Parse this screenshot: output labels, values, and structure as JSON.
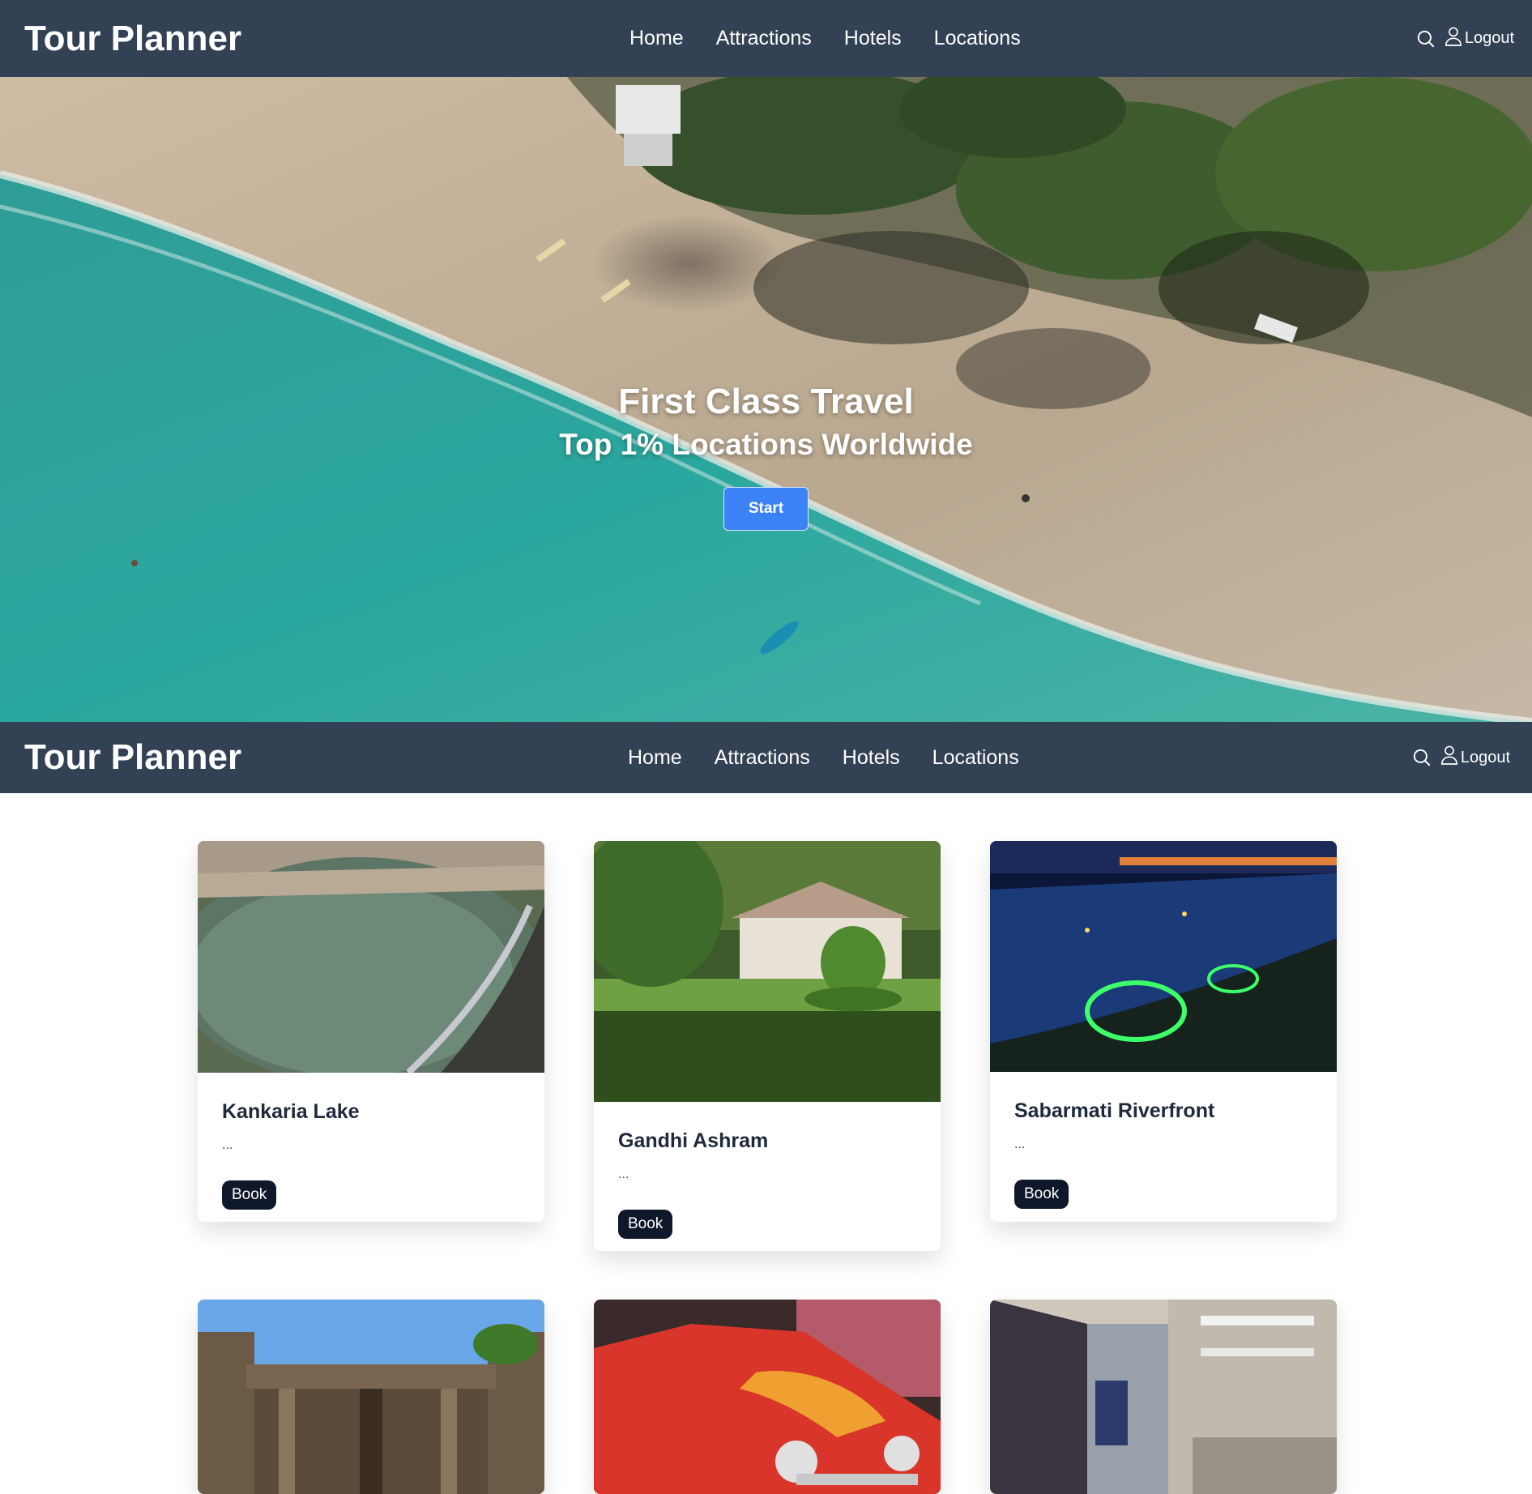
{
  "nav": {
    "brand": "Tour Planner",
    "links": [
      "Home",
      "Attractions",
      "Hotels",
      "Locations"
    ],
    "logout": "Logout"
  },
  "hero": {
    "title": "First Class Travel",
    "subtitle": "Top 1% Locations Worldwide",
    "cta": "Start"
  },
  "cards": [
    {
      "title": "Kankaria Lake",
      "desc": "...",
      "button": "Book"
    },
    {
      "title": "Gandhi Ashram",
      "desc": "...",
      "button": "Book"
    },
    {
      "title": "Sabarmati Riverfront",
      "desc": "...",
      "button": "Book"
    },
    {
      "title": "",
      "desc": "",
      "button": ""
    },
    {
      "title": "",
      "desc": "",
      "button": ""
    },
    {
      "title": "",
      "desc": "",
      "button": ""
    }
  ],
  "colors": {
    "navbar": "#334155",
    "primary": "#3b82f6",
    "book_button": "#0f172a"
  },
  "icons": [
    "search-icon",
    "user-icon"
  ]
}
